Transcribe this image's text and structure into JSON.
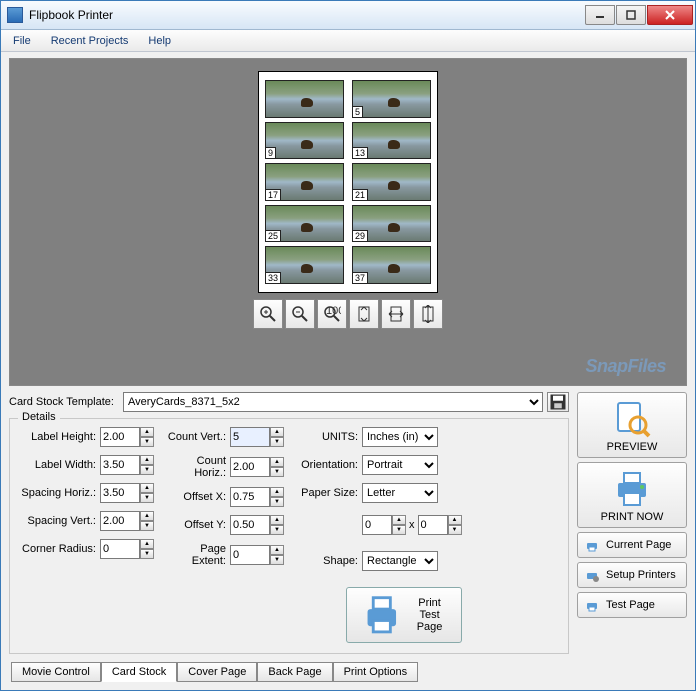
{
  "window": {
    "title": "Flipbook Printer"
  },
  "menubar": {
    "file": "File",
    "recent": "Recent Projects",
    "help": "Help"
  },
  "watermark": "SnapFiles",
  "page_cards": [
    {
      "num": ""
    },
    {
      "num": "5"
    },
    {
      "num": "9"
    },
    {
      "num": "13"
    },
    {
      "num": "17"
    },
    {
      "num": "21"
    },
    {
      "num": "25"
    },
    {
      "num": "29"
    },
    {
      "num": "33"
    },
    {
      "num": "37"
    }
  ],
  "zoom_icons": [
    "zoom-in-icon",
    "zoom-out-icon",
    "zoom-100-icon",
    "fit-page-icon",
    "fit-width-icon",
    "fit-height-icon"
  ],
  "template": {
    "label": "Card Stock Template:",
    "value": "AveryCards_8371_5x2"
  },
  "details": {
    "legend": "Details",
    "labels": {
      "label_height": "Label Height:",
      "label_width": "Label Width:",
      "spacing_horiz": "Spacing Horiz.:",
      "spacing_vert": "Spacing Vert.:",
      "corner_radius": "Corner Radius:",
      "count_vert": "Count Vert.:",
      "count_horiz": "Count Horiz.:",
      "offset_x": "Offset X:",
      "offset_y": "Offset Y:",
      "page_extent": "Page Extent:",
      "units": "UNITS:",
      "orientation": "Orientation:",
      "paper_size": "Paper Size:",
      "shape": "Shape:"
    },
    "values": {
      "label_height": "2.00",
      "label_width": "3.50",
      "spacing_horiz": "3.50",
      "spacing_vert": "2.00",
      "corner_radius": "0",
      "count_vert": "5",
      "count_horiz": "2.00",
      "offset_x": "0.75",
      "offset_y": "0.50",
      "page_extent": "0",
      "units": "Inches (in)",
      "orientation": "Portrait",
      "paper_size": "Letter",
      "paper_w": "0",
      "paper_h": "0",
      "shape": "Rectangle"
    },
    "by": "x",
    "print_test": "Print Test Page"
  },
  "right": {
    "preview": "PREVIEW",
    "print_now": "PRINT NOW",
    "current_page": "Current Page",
    "setup_printers": "Setup Printers",
    "test_page": "Test Page"
  },
  "tabs": {
    "movie": "Movie Control",
    "card": "Card Stock",
    "cover": "Cover Page",
    "back": "Back Page",
    "print": "Print Options"
  }
}
